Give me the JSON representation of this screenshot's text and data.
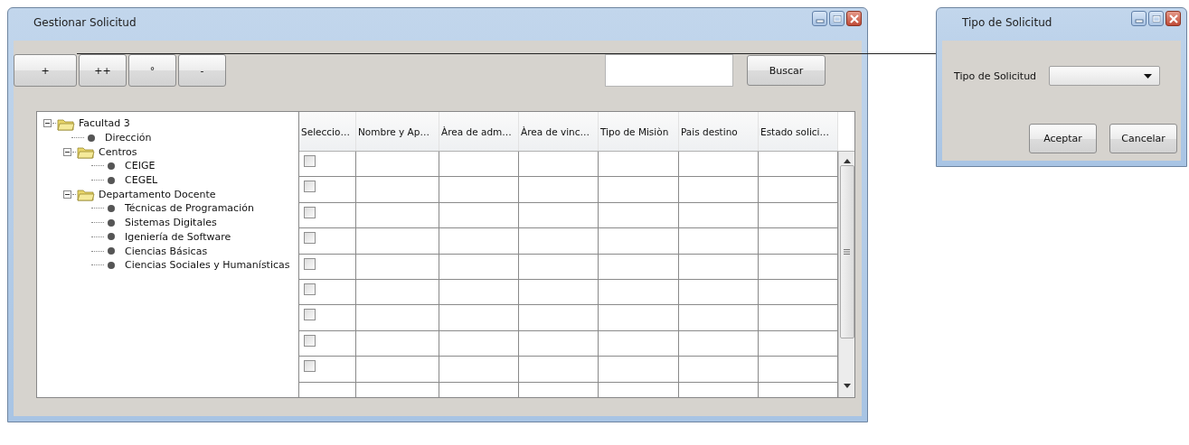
{
  "main_window": {
    "title": "Gestionar Solicitud",
    "toolbar": {
      "buttons": [
        "+",
        "++",
        "°",
        "-"
      ],
      "search_button": "Buscar"
    },
    "tree": [
      {
        "label": "Facultad 3",
        "kind": "folder",
        "expanded": true,
        "children": [
          {
            "label": "Dirección",
            "kind": "leaf"
          },
          {
            "label": "Centros",
            "kind": "folder",
            "expanded": true,
            "children": [
              {
                "label": "CEIGE",
                "kind": "leaf"
              },
              {
                "label": "CEGEL",
                "kind": "leaf"
              }
            ]
          },
          {
            "label": "Departamento Docente",
            "kind": "folder",
            "expanded": true,
            "children": [
              {
                "label": "Técnicas de Programación",
                "kind": "leaf"
              },
              {
                "label": "Sistemas Digitales",
                "kind": "leaf"
              },
              {
                "label": "Igeniería de Software",
                "kind": "leaf"
              },
              {
                "label": "Ciencias Básicas",
                "kind": "leaf"
              },
              {
                "label": "Ciencias Sociales y Humanísticas",
                "kind": "leaf"
              }
            ]
          }
        ]
      }
    ],
    "table": {
      "columns": [
        "Seleccio…",
        "Nombre y Ap…",
        "Àrea de adm…",
        "Àrea de vinc…",
        "Tipo de Misiòn",
        "Pais destino",
        "Estado solici…"
      ],
      "rows": [
        {
          "kind": "checkbox",
          "checked": false
        },
        {
          "kind": "checkbox",
          "checked": false
        },
        {
          "kind": "checkbox",
          "checked": false
        },
        {
          "kind": "checkbox",
          "checked": false
        },
        {
          "kind": "checkbox",
          "checked": false
        },
        {
          "kind": "checkbox",
          "checked": false
        },
        {
          "kind": "checkbox",
          "checked": false
        },
        {
          "kind": "checkbox",
          "checked": false
        },
        {
          "kind": "checkbox",
          "checked": false
        },
        {
          "kind": "empty"
        }
      ]
    }
  },
  "dialog": {
    "title": "Tipo de Solicitud",
    "field_label": "Tipo de Solicitud",
    "buttons": [
      "Aceptar",
      "Cancelar"
    ]
  }
}
